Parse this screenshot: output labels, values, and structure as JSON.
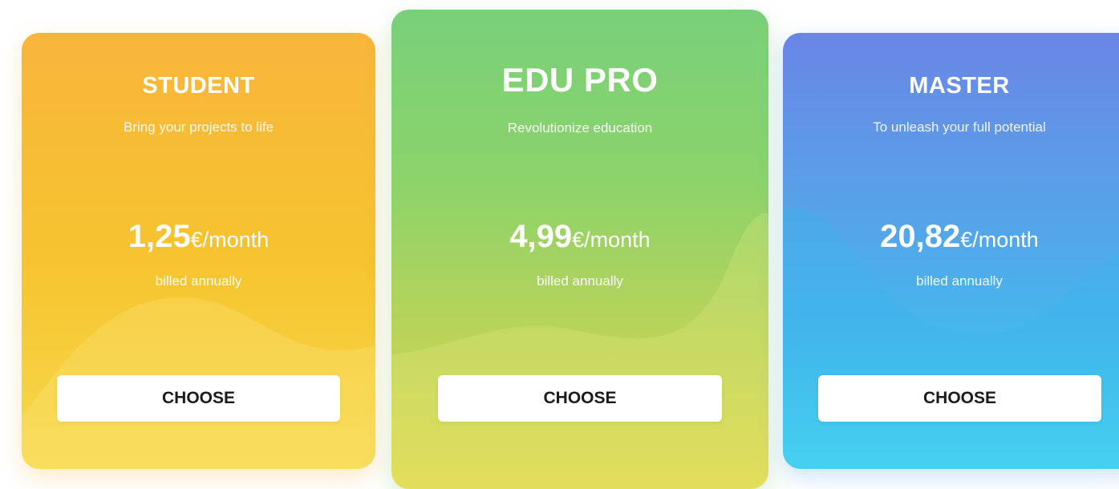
{
  "plans": [
    {
      "name": "STUDENT",
      "tagline": "Bring your projects to life",
      "amount": "1,25",
      "unit": "€/month",
      "billing": "billed annually",
      "button_label": "CHOOSE"
    },
    {
      "name": "EDU PRO",
      "tagline": "Revolutionize education",
      "amount": "4,99",
      "unit": "€/month",
      "billing": "billed annually",
      "button_label": "CHOOSE"
    },
    {
      "name": "MASTER",
      "tagline": "To unleash your full potential",
      "amount": "20,82",
      "unit": "€/month",
      "billing": "billed annually",
      "button_label": "CHOOSE"
    }
  ],
  "colors": {
    "student": "#f6c52f",
    "edu_pro": "#8bd36b",
    "master": "#44b8ec",
    "button_bg": "#ffffff",
    "button_text": "#1b1b1b"
  }
}
